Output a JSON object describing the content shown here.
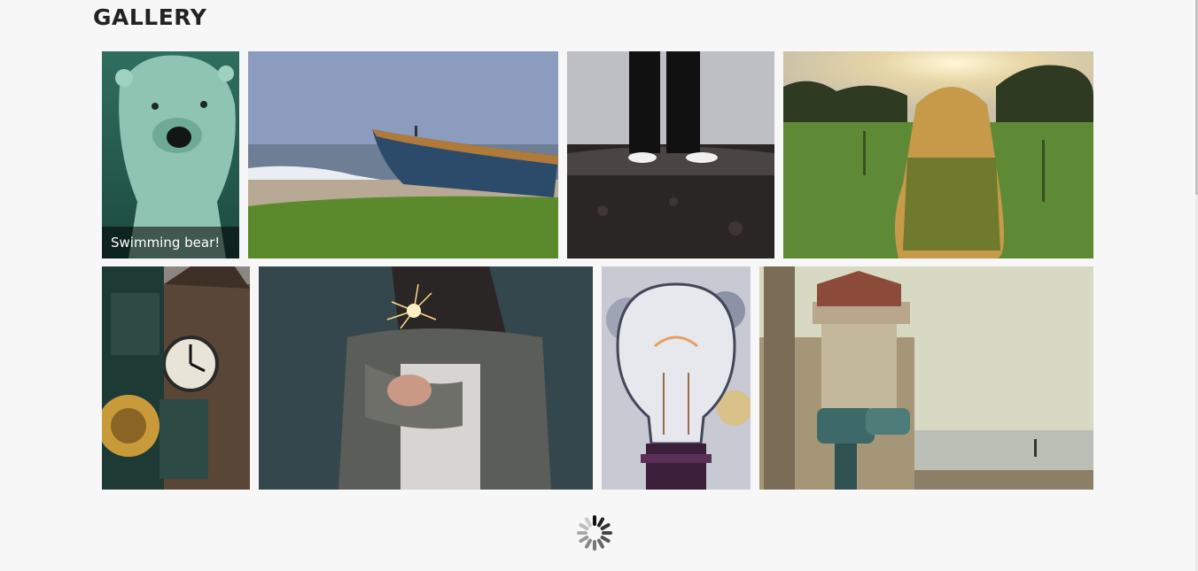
{
  "page": {
    "title": "GALLERY"
  },
  "gallery": {
    "tiles": [
      {
        "subject": "polar bear swimming",
        "caption": "Swimming bear!"
      },
      {
        "subject": "wooden boat on beach"
      },
      {
        "subject": "person standing on pebbles"
      },
      {
        "subject": "girl in sunlit field"
      },
      {
        "subject": "clock tower with street lamp"
      },
      {
        "subject": "woman holding sparkler"
      },
      {
        "subject": "light bulb"
      },
      {
        "subject": "lighthouse with viewer telescope"
      }
    ]
  },
  "loader": {
    "icon": "loading-spinner-icon"
  }
}
